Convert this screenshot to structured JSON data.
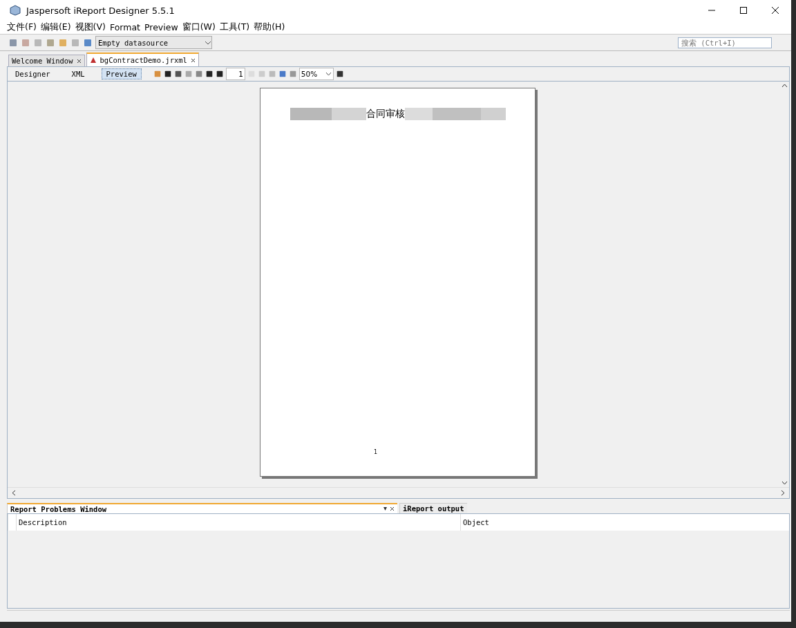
{
  "window": {
    "title": "Jaspersoft iReport Designer 5.5.1"
  },
  "menu": [
    "文件(F)",
    "编辑(E)",
    "视图(V)",
    "Format",
    "Preview",
    "窗口(W)",
    "工具(T)",
    "帮助(H)"
  ],
  "toolbar": {
    "datasource": "Empty datasource",
    "search_placeholder": "搜索 (Ctrl+I)"
  },
  "doc_tabs": [
    {
      "label": "Welcome Window",
      "selected": false
    },
    {
      "label": "bgContractDemo.jrxml",
      "selected": true
    }
  ],
  "view_tabs": [
    {
      "label": "Designer",
      "selected": false
    },
    {
      "label": "XML",
      "selected": false
    },
    {
      "label": "Preview",
      "selected": true
    }
  ],
  "preview": {
    "page_field": "1",
    "zoom": "50%",
    "report_title": "合同审核",
    "page_number": "1"
  },
  "bottom_tabs": [
    {
      "label": "Report Problems Window",
      "selected": true
    },
    {
      "label": "iReport output",
      "selected": false
    }
  ],
  "table": {
    "columns": [
      "Description",
      "Object"
    ]
  }
}
